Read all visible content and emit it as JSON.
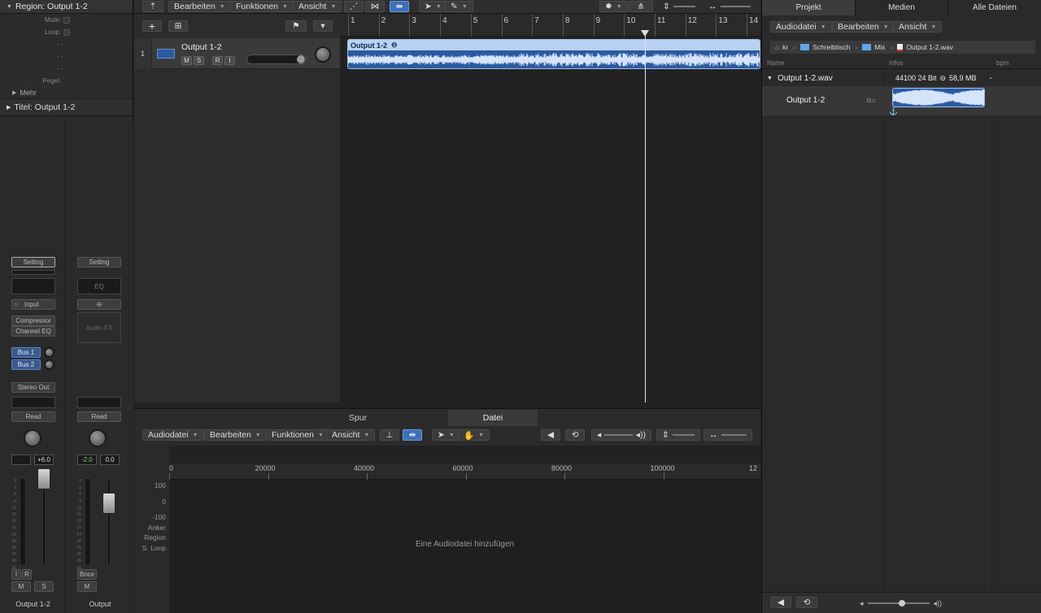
{
  "inspector": {
    "region_header": "Region: Output 1-2",
    "rows": [
      {
        "label": "Mute:",
        "type": "check"
      },
      {
        "label": "Loop:",
        "type": "check"
      },
      {
        "label": "",
        "type": "dash",
        "value": "- -"
      },
      {
        "label": "",
        "type": "dash",
        "value": "- -"
      },
      {
        "label": "",
        "type": "dash",
        "value": "- -"
      },
      {
        "label": "Pegel:",
        "type": "blank"
      }
    ],
    "mehr": "Mehr",
    "title_header": "Titel: Output 1-2",
    "strip1": {
      "setting": "Setting",
      "input": "Input",
      "plugins": [
        "Compressor",
        "Channel EQ"
      ],
      "sends": [
        "Bus 1",
        "Bus 2"
      ],
      "output": "Stereo Out",
      "automation": "Read",
      "vol_l": "",
      "vol_r": "+6.0",
      "io": [
        "I",
        "R"
      ],
      "ms": [
        "M",
        "S"
      ],
      "name": "Output 1-2"
    },
    "strip2": {
      "setting": "Setting",
      "eq": "EQ",
      "audiofx": "Audio FX",
      "automation": "Read",
      "vol_l": "-2.0",
      "vol_r": "0.0",
      "bnce": "Bnce",
      "ms": [
        "M"
      ],
      "name": "Output"
    },
    "scale": [
      "0",
      "3",
      "6",
      "9",
      "12",
      "15",
      "18",
      "21",
      "24",
      "30",
      "35",
      "40",
      "45",
      "50",
      "60"
    ]
  },
  "toolbar": {
    "edit": "Bearbeiten",
    "functions": "Funktionen",
    "view": "Ansicht"
  },
  "track": {
    "number": "1",
    "name": "Output 1-2",
    "buttons": [
      "M",
      "S",
      "R",
      "I"
    ]
  },
  "ruler": {
    "bars": [
      "1",
      "2",
      "3",
      "4",
      "5",
      "6",
      "7",
      "8",
      "9",
      "10",
      "11",
      "12",
      "13",
      "14"
    ]
  },
  "region": {
    "name": "Output 1-2"
  },
  "editor": {
    "tabs": [
      "Spur",
      "Datei"
    ],
    "toolbar": {
      "audiofile": "Audiodatei",
      "edit": "Bearbeiten",
      "functions": "Funktionen",
      "view": "Ansicht"
    },
    "ruler_ticks": [
      "0",
      "20000",
      "40000",
      "60000",
      "80000",
      "100000",
      "12"
    ],
    "side_labels": [
      "100",
      "0",
      "-100",
      "Anker",
      "Region",
      "S. Loop"
    ],
    "empty_text": "Eine Audiodatei hinzufügen"
  },
  "browser": {
    "tabs": [
      "Projekt",
      "Medien",
      "Alle Dateien"
    ],
    "toolbar": {
      "audiofile": "Audiodatei",
      "edit": "Bearbeiten",
      "view": "Ansicht"
    },
    "path": [
      "kr",
      "Schreibtisch",
      "Mix",
      "Output 1-2.wav"
    ],
    "columns": {
      "name": "Name",
      "info": "Infos",
      "bpm": "bpm"
    },
    "file": {
      "name": "Output 1-2.wav",
      "info": "44100  24 Bit",
      "size": "58,9 MB",
      "bpm": "-"
    },
    "region": {
      "name": "Output 1-2"
    }
  },
  "colors": {
    "accent": "#3e6fb8",
    "region": "#2a5aa0",
    "region_title": "#b9d1f2"
  }
}
